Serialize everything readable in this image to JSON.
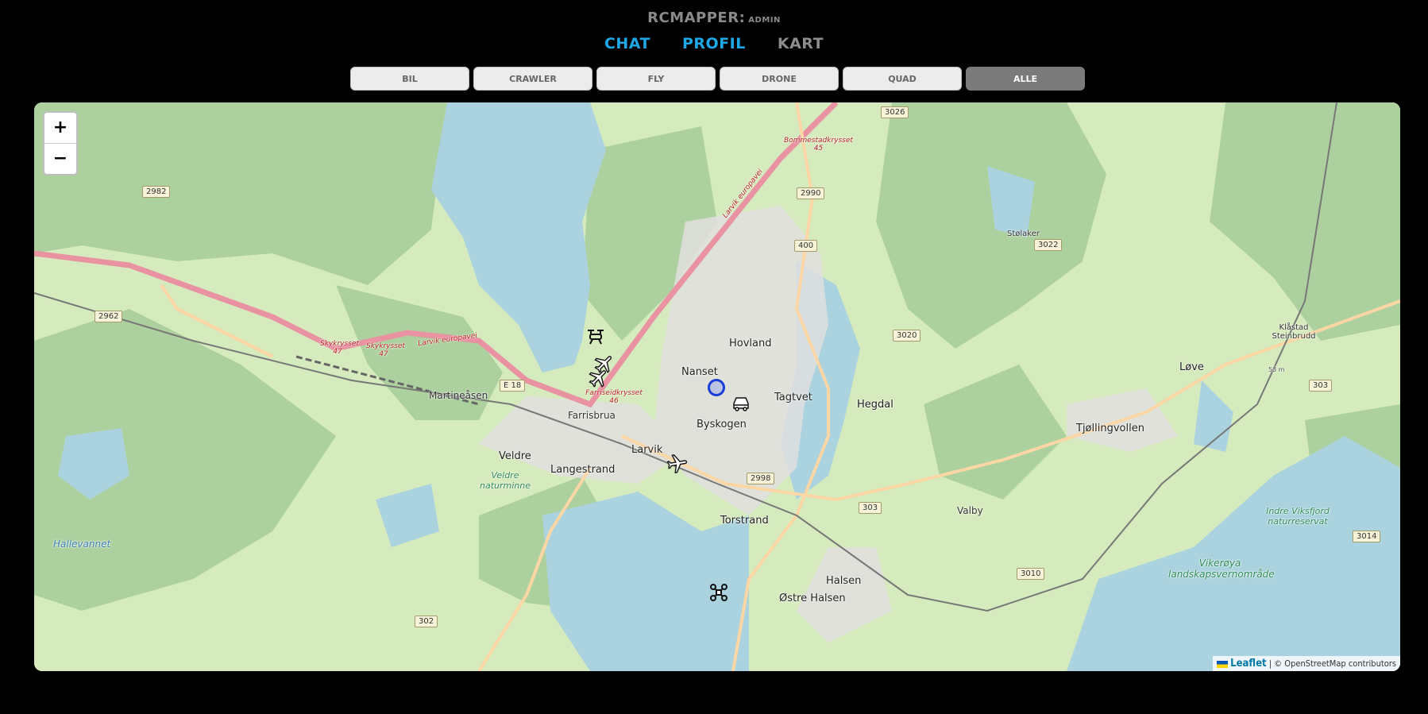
{
  "header": {
    "app_name": "RCMAPPER:",
    "user_role": "ADMIN"
  },
  "nav": {
    "chat": "CHAT",
    "profil": "PROFIL",
    "kart": "KART"
  },
  "filters": [
    "BIL",
    "CRAWLER",
    "FLY",
    "DRONE",
    "QUAD",
    "ALLE"
  ],
  "active_filter": "ALLE",
  "map": {
    "zoom_in": "+",
    "zoom_out": "−",
    "attribution": {
      "leaflet": "Leaflet",
      "osm": "© OpenStreetMap contributors",
      "sep": "|"
    },
    "places": {
      "hovland": "Hovland",
      "nanset": "Nanset",
      "tagtvet": "Tagtvet",
      "byskogen": "Byskogen",
      "larvik": "Larvik",
      "langestrand": "Langestrand",
      "veldre": "Veldre",
      "farrisbrua": "Farrisbrua",
      "martineasen": "Martineåsen",
      "hegdal": "Hegdal",
      "tjollingvollen": "Tjøllingvollen",
      "love": "Løve",
      "valby": "Valby",
      "torstrand": "Torstrand",
      "halsen": "Halsen",
      "ostre_halsen": "Østre Halsen",
      "stolaker": "Stølaker",
      "klastad": "Klåstad Steinbrudd",
      "hallevannet": "Hallevannet"
    },
    "roads": {
      "skykrysset1": "Skykrysset 47",
      "skykrysset2": "Skykrysset 47",
      "larvik_europavei_w": "Larvik europavei",
      "larvik_europavei_n": "Larvik europavei",
      "farriseidkrysset": "Farriseidkrysset 46",
      "bommestadkrysset": "Bommestadkrysset 45",
      "e18": "E 18"
    },
    "nature": {
      "veldre_naturminne": "Veldre naturminne",
      "indre_viksfjord": "Indre Viksfjord naturreservat",
      "vikeroya": "Vikerøya landskapsvernområde"
    },
    "shields": [
      "3026",
      "2982",
      "2990",
      "400",
      "2962",
      "3022",
      "3020",
      "303",
      "2998",
      "303",
      "3010",
      "3014",
      "302"
    ],
    "elevation": "53 m",
    "markers": [
      {
        "type": "drone",
        "icon": "drone-icon"
      },
      {
        "type": "fly",
        "icon": "airplane-icon"
      },
      {
        "type": "fly",
        "icon": "airplane-icon"
      },
      {
        "type": "fly",
        "icon": "airplane-icon"
      },
      {
        "type": "bil",
        "icon": "car-icon"
      },
      {
        "type": "quad",
        "icon": "quadcopter-icon"
      },
      {
        "type": "position",
        "icon": "location-circle-icon"
      }
    ]
  }
}
